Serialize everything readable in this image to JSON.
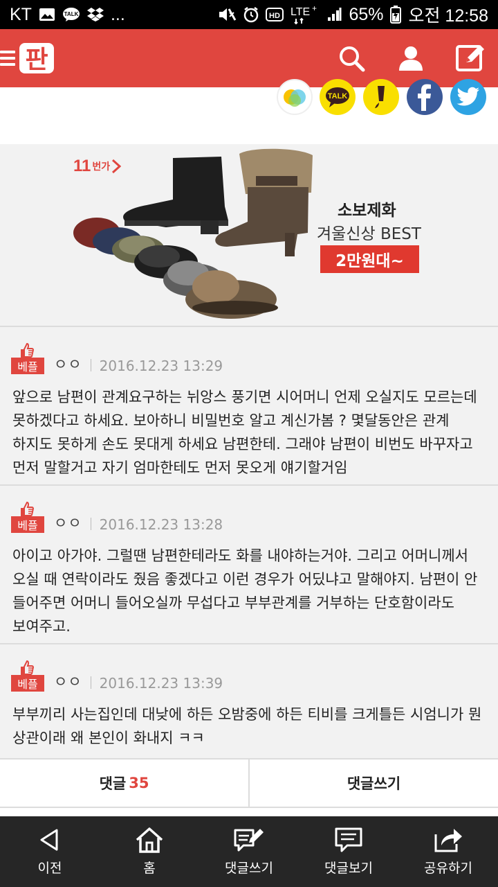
{
  "status_bar": {
    "carrier": "KT",
    "more": "...",
    "lte": "LTE",
    "battery": "65%",
    "time": "오전 12:58"
  },
  "header": {
    "logo_text": "판"
  },
  "ad": {
    "badge_num": "11",
    "badge_small": "번가",
    "title": "소보제화",
    "subtitle": "겨울신상 BEST",
    "price": "2만원대~"
  },
  "comments": [
    {
      "badge": "베플",
      "author": "ㅇㅇ",
      "date": "2016.12.23 13:29",
      "body": "앞으로 남편이 관계요구하는 뉘앙스 풍기면 시어머니 언제 오실지도 모르는데 못하겠다고 하세요. 보아하니 비밀번호 알고 계신가봄 ? 몇달동안은 관계 하지도 못하게 손도 못대게 하세요 남편한테. 그래야 남편이 비번도 바꾸자고 먼저 말할거고 자기 엄마한테도 먼저 못오게 얘기할거임"
    },
    {
      "badge": "베플",
      "author": "ㅇㅇ",
      "date": "2016.12.23 13:28",
      "body": "아이고 아가야. 그럴땐 남편한테라도 화를 내야하는거야. 그리고 어머니께서 오실 때 연락이라도 줬음 좋겠다고 이런 경우가 어딨냐고 말해야지. 남편이 안 들어주면 어머니 들어오실까 무섭다고 부부관계를 거부하는 단호함이라도 보여주고."
    },
    {
      "badge": "베플",
      "author": "ㅇㅇ",
      "date": "2016.12.23 13:39",
      "body": "부부끼리 사는집인데 대낮에 하든 오밤중에 하든 티비를 크게틀든 시엄니가 뭔 상관이래 왜 본인이 화내지 ㅋㅋ"
    }
  ],
  "comment_bar": {
    "comments_label": "댓글",
    "comments_count": "35",
    "write_label": "댓글쓰기"
  },
  "bottom_nav": {
    "back": "이전",
    "home": "홈",
    "write": "댓글쓰기",
    "view": "댓글보기",
    "share": "공유하기"
  },
  "colors": {
    "brand": "#e0463f",
    "nav_bg": "#262626",
    "kakao_yellow": "#f9df00",
    "facebook": "#3b5998",
    "twitter": "#2ea3e3"
  }
}
